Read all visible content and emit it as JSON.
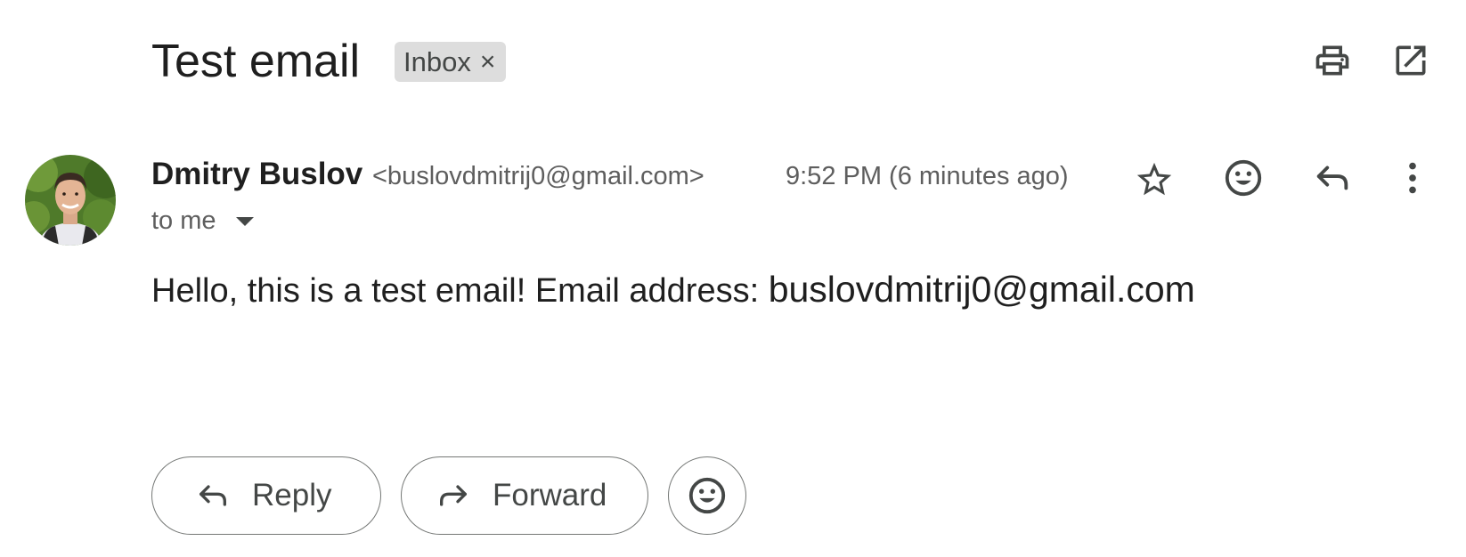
{
  "header": {
    "subject": "Test email",
    "label": "Inbox",
    "label_remove": "×",
    "actions": [
      "print-icon",
      "open-in-new-window-icon"
    ]
  },
  "message": {
    "sender_name": "Dmitry Buslov",
    "sender_email": "<buslovdmitrij0@gmail.com>",
    "timestamp": "9:52 PM (6 minutes ago)",
    "recipient": "to me",
    "body_text": "Hello, this is a test email! Email address: ",
    "body_link": "buslovdmitrij0@gmail.com",
    "actions": [
      "star-icon",
      "emoji-reaction-icon",
      "reply-icon",
      "more-options-icon"
    ]
  },
  "footer": {
    "reply_label": "Reply",
    "forward_label": "Forward"
  },
  "colors": {
    "text_primary": "#1f1f1f",
    "text_secondary": "#5e5e5e",
    "chip_background": "#dddddd",
    "button_border": "#747775",
    "icon": "#444746"
  }
}
